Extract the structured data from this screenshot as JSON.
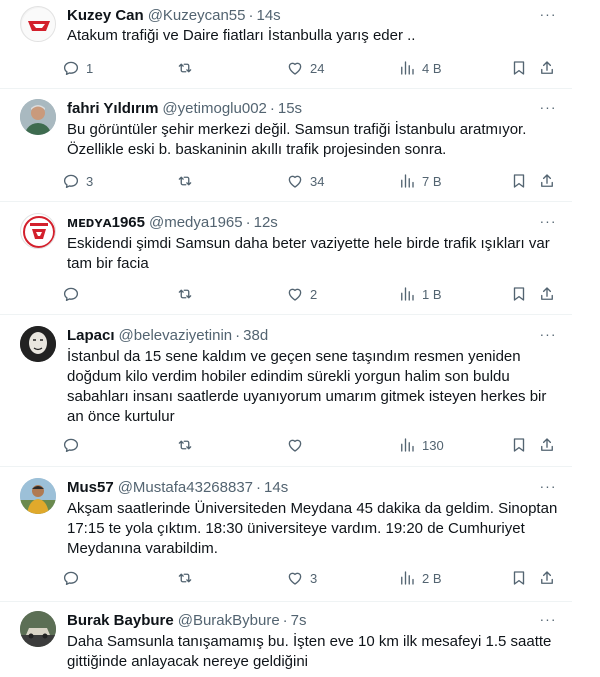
{
  "tweets": [
    {
      "name": "Kuzey Can",
      "handle": "@Kuzeycan55",
      "time": "14s",
      "text": "Atakum trafiği ve Daire fiatları İstanbulla yarış eder ..",
      "replies": "1",
      "reposts": "",
      "likes": "24",
      "views": "4 B",
      "avatar": "red-white-club-logo"
    },
    {
      "name": "fahri Yıldırım",
      "handle": "@yetimoglu002",
      "time": "15s",
      "text": "Bu görüntüler şehir merkezi değil. Samsun trafiği İstanbulu aratmıyor. Özellikle eski b. baskaninin akıllı trafik projesinden sonra.",
      "replies": "3",
      "reposts": "",
      "likes": "34",
      "views": "7 B",
      "avatar": "man-photo"
    },
    {
      "name": "ᴍᴇᴅʏᴀ1965",
      "handle": "@medya1965",
      "time": "12s",
      "text": "Eskidendi şimdi Samsun daha beter vaziyette hele birde trafik ışıkları var tam bir facia",
      "replies": "",
      "reposts": "",
      "likes": "2",
      "views": "1 B",
      "avatar": "samsunspor-badge"
    },
    {
      "name": "Lapacı",
      "handle": "@belevaziyetinin",
      "time": "38d",
      "text": "İstanbul da 15 sene kaldım ve geçen sene taşındım resmen yeniden doğdum kilo verdim hobiler edindim sürekli yorgun halim son buldu sabahları insanı saatlerde uyanıyorum umarım  gitmek isteyen herkes bir an önce kurtulur",
      "replies": "",
      "reposts": "",
      "likes": "",
      "views": "130",
      "avatar": "mask-photo"
    },
    {
      "name": "Mus57",
      "handle": "@Mustafa43268837",
      "time": "14s",
      "text": "Akşam saatlerinde Üniversiteden Meydana 45 dakika da geldim. Sinoptan 17:15 te yola çıktım. 18:30 üniversiteye vardım. 19:20 de Cumhuriyet Meydanına varabildim.",
      "replies": "",
      "reposts": "",
      "likes": "3",
      "views": "2 B",
      "avatar": "man-outdoor-photo"
    },
    {
      "name": "Burak Baybure",
      "handle": "@BurakBybure",
      "time": "7s",
      "text": "Daha Samsunla tanışamamış bu. İşten eve 10 km ilk mesafeyi 1.5 saatte gittiğinde anlayacak nereye geldiğini",
      "replies": "",
      "reposts": "",
      "likes": "",
      "views": "",
      "avatar": "car-photo"
    }
  ],
  "ui": {
    "dot": "·",
    "more": "···"
  }
}
